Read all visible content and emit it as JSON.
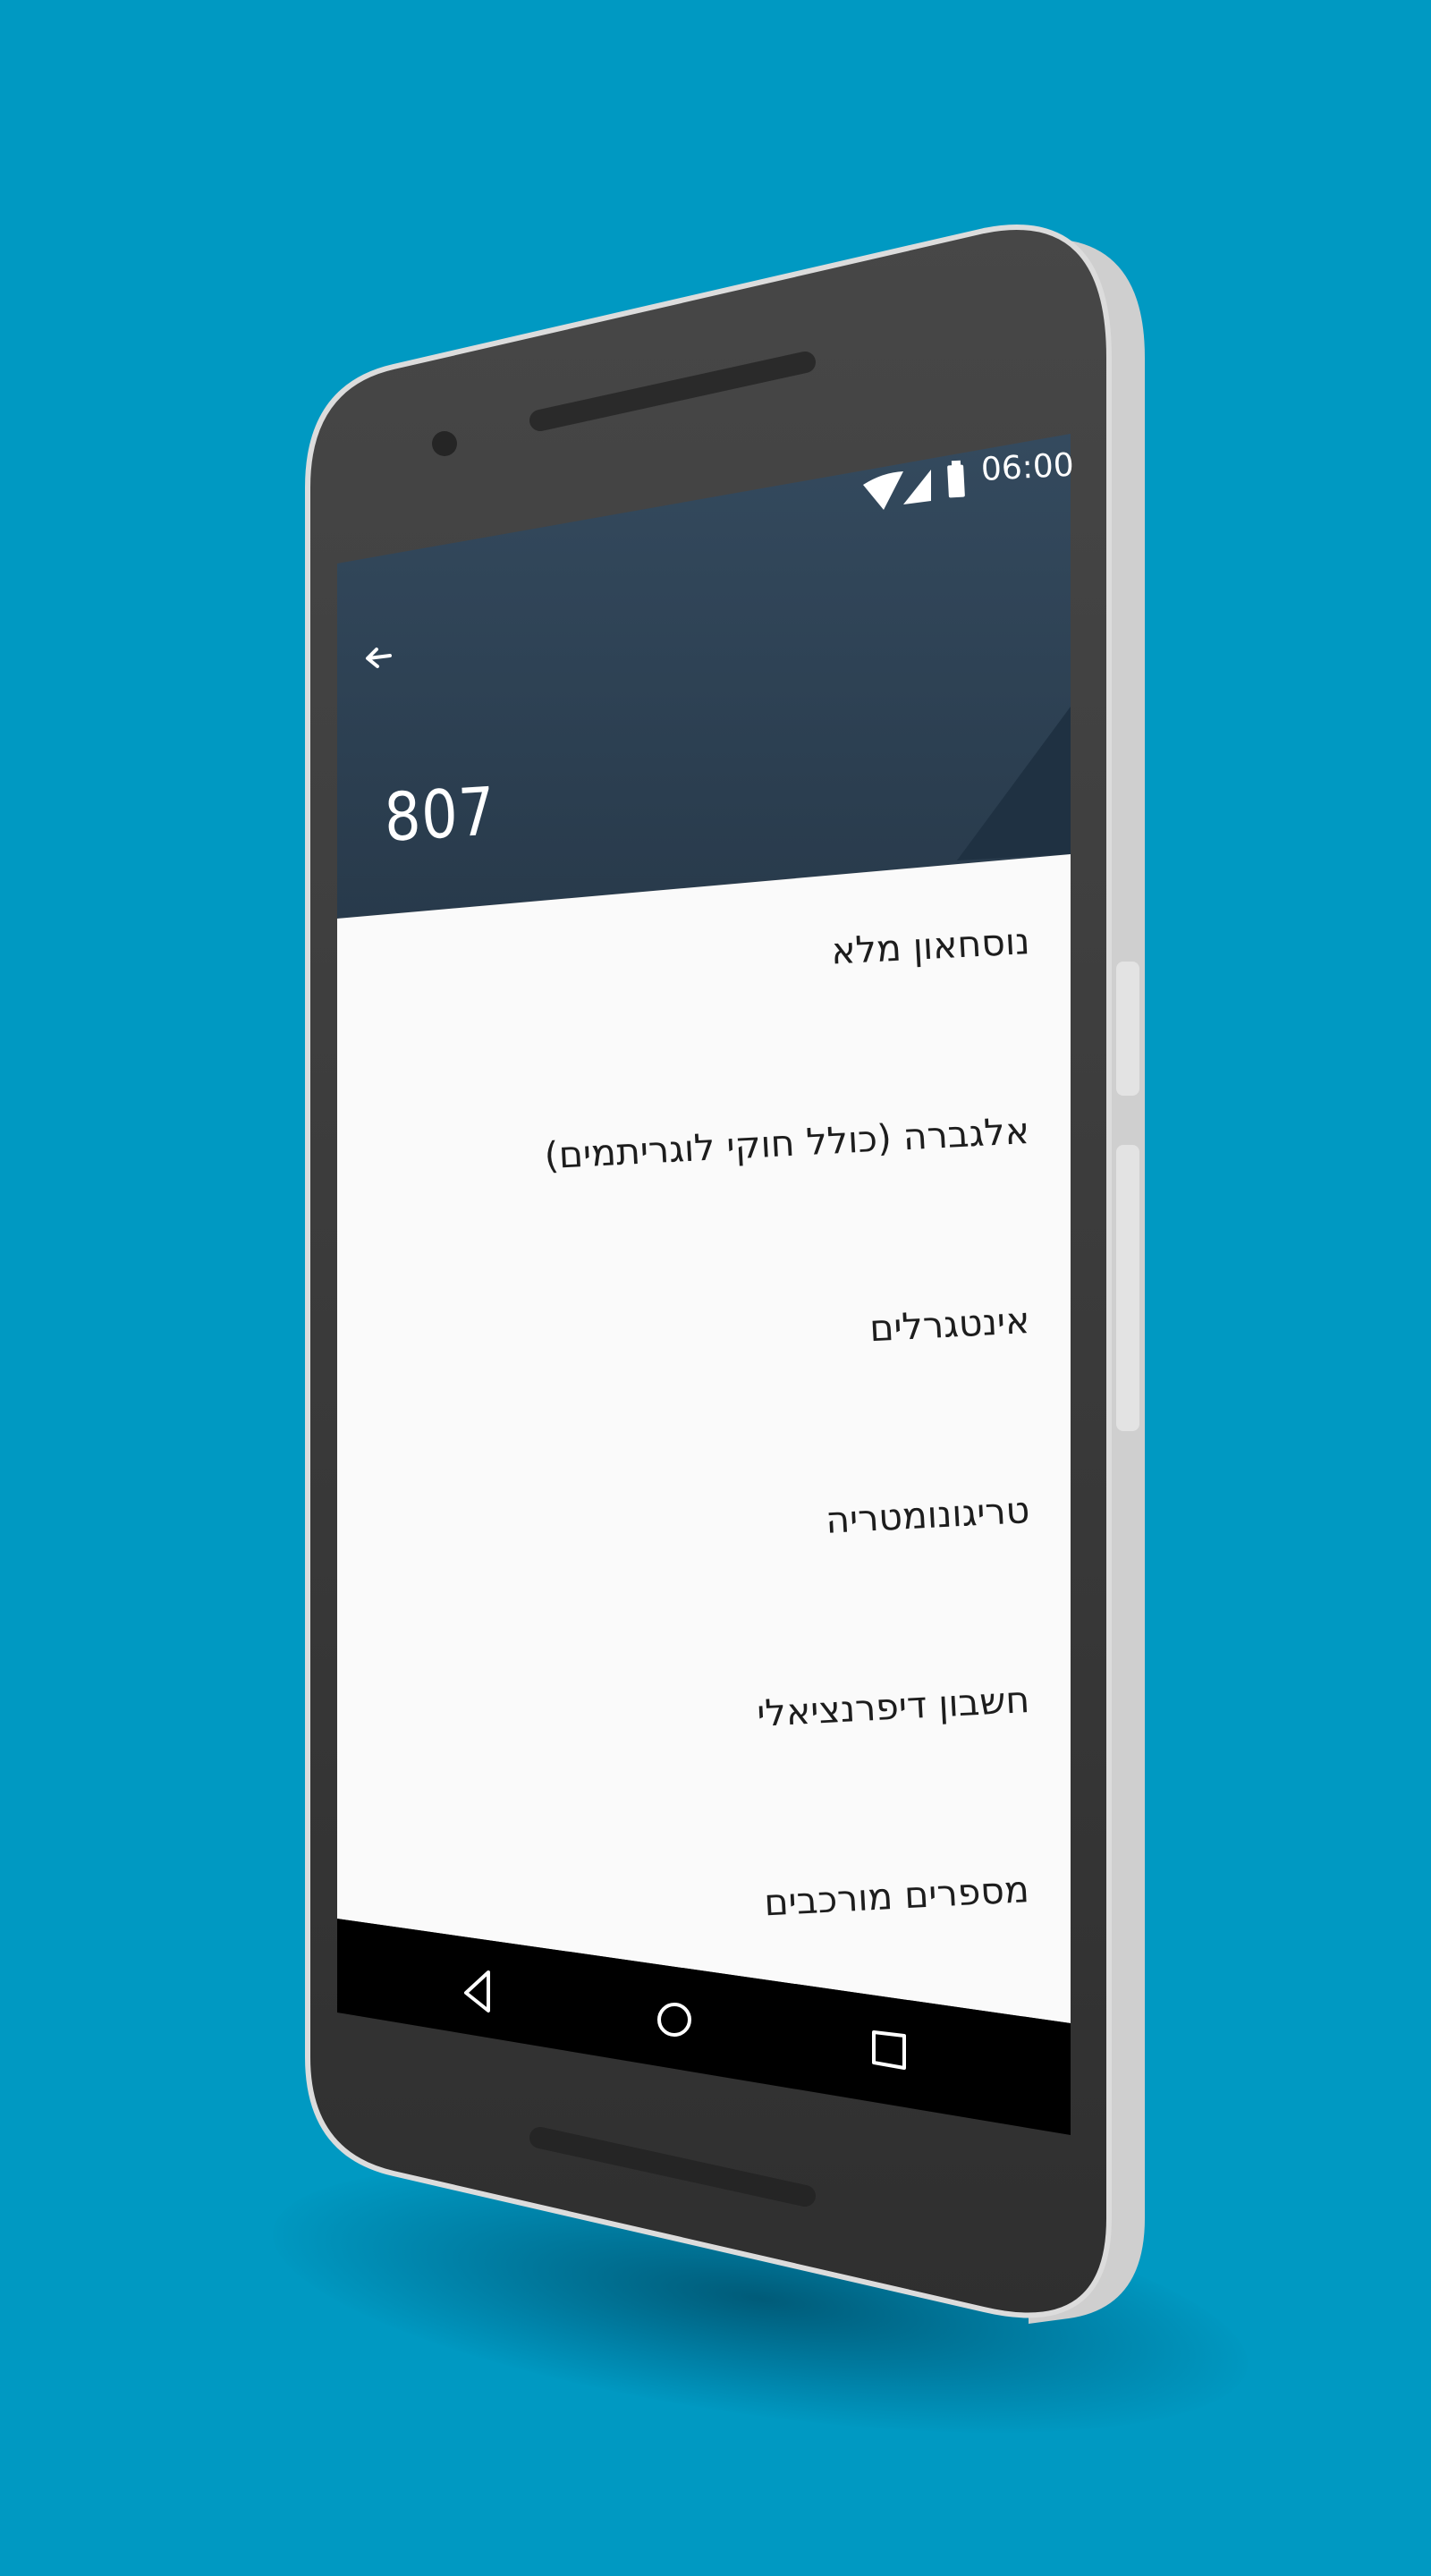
{
  "status_bar": {
    "time": "06:00",
    "icons": [
      "wifi-icon",
      "signal-icon",
      "battery-icon"
    ]
  },
  "app_bar": {
    "back_icon": "arrow-left-icon",
    "title": "807",
    "colors": {
      "header": "#2e4356",
      "header_dark": "#1f3142"
    }
  },
  "list": {
    "items": [
      {
        "label": "נוסחאון מלא"
      },
      {
        "label": "אלגברה (כולל חוקי לוגריתמים)"
      },
      {
        "label": "אינטגרלים"
      },
      {
        "label": "טריגונומטריה"
      },
      {
        "label": "חשבון דיפרנציאלי"
      },
      {
        "label": "מספרים מורכבים"
      }
    ]
  },
  "nav_bar": {
    "back": "triangle-back-icon",
    "home": "circle-home-icon",
    "recents": "square-recents-icon"
  },
  "colors": {
    "background": "#0099c2",
    "device_body": "#3a3a3a",
    "list_background": "#fafafa"
  }
}
